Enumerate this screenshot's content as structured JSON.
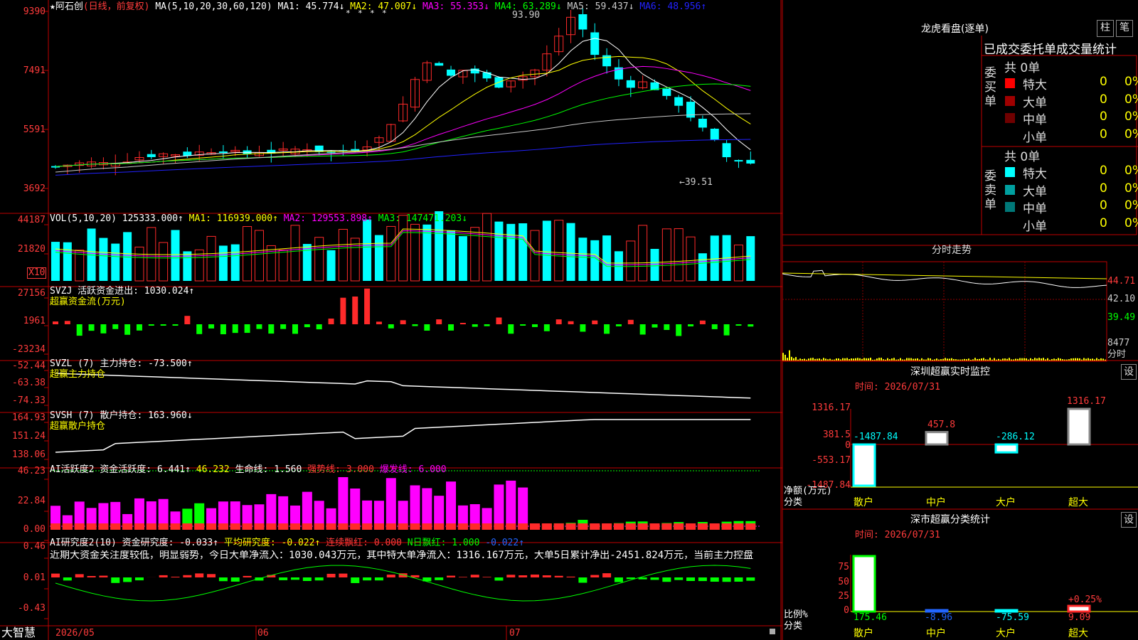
{
  "main": {
    "stock": "阿石创",
    "period": "(日线，前复权)",
    "ma_title": "MA(5,10,20,30,60,120)",
    "ma": [
      {
        "label": "MA1:",
        "value": "45.774↓",
        "color": "#ffffff"
      },
      {
        "label": "MA2:",
        "value": "47.007↓",
        "color": "#ffff00"
      },
      {
        "label": "MA3:",
        "value": "55.353↓",
        "color": "#ff00ff"
      },
      {
        "label": "MA4:",
        "value": "63.289↓",
        "color": "#00ff00"
      },
      {
        "label": "MA5:",
        "value": "59.437↓",
        "color": "#c8c8c8"
      },
      {
        "label": "MA6:",
        "value": "48.956↑",
        "color": "#2222ff"
      }
    ],
    "y": [
      "9390",
      "7491",
      "5591",
      "3692"
    ],
    "high_mark": "93.90",
    "low_mark": "←39.51"
  },
  "vol": {
    "title": "VOL(5,10,20)",
    "value": "125333.000↑",
    "ma": [
      {
        "label": "MA1:",
        "value": "116939.000↑",
        "color": "#ffff00"
      },
      {
        "label": "MA2:",
        "value": "129553.898↑",
        "color": "#ff00ff"
      },
      {
        "label": "MA3:",
        "value": "147471.203↓",
        "color": "#00ff00"
      }
    ],
    "y": [
      "44187",
      "21820"
    ],
    "unit": "X10"
  },
  "svzj": {
    "title": "SVZJ  活跃资金进出: 1030.024↑",
    "sub": "超赢资金流(万元)",
    "y": [
      "27156",
      "1961",
      "-23234"
    ]
  },
  "svzl": {
    "title": "SVZL (7) 主力持仓: -73.500↑",
    "sub": "超赢主力持仓",
    "y": [
      "-52.44",
      "-63.38",
      "-74.33"
    ]
  },
  "svsh": {
    "title": "SVSH (7) 散户持仓: 163.960↓",
    "sub": "超赢散户持仓",
    "y": [
      "164.93",
      "151.24",
      "138.06"
    ]
  },
  "ai1": {
    "title": "AI活跃度2 资金活跃度: 6.441↑",
    "v2": "46.232",
    "life": "生命线: 1.560",
    "strong": "强势线: 3.000",
    "burst": "爆发线: 6.000",
    "y": [
      "46.23",
      "22.84",
      "0.00"
    ]
  },
  "ai2": {
    "title": "AI研究度2(10) 资金研究度: -0.033↑",
    "avg": "平均研究度: -0.022↑",
    "red": "连续飘红: 0.000",
    "nred": "N日飘红: 1.000",
    "last": "-0.022↑",
    "commentary": "近期大资金关注度较低，明显弱势，今日大单净流入：1030.043万元，其中特大单净流入：1316.167万元，大单5日累计净出-2451.824万元，当前主力控盘",
    "y": [
      "0.46",
      "0.01",
      "-0.43"
    ]
  },
  "footer": {
    "brand": "大智慧",
    "months": [
      "2026/05",
      "06",
      "07"
    ]
  },
  "dragon": {
    "title": "龙虎看盘(逐单)",
    "btn1": "柱",
    "btn2": "笔",
    "header": "已成交委托单成交量统计",
    "buy_label": "委买单",
    "sell_label": "委卖单",
    "buy_total": "共 0单",
    "sell_total": "共 0单",
    "buy": [
      {
        "name": "特大",
        "count": "0",
        "pct": "0%",
        "color": "#ff0000"
      },
      {
        "name": "大单",
        "count": "0",
        "pct": "0%",
        "color": "#a00000"
      },
      {
        "name": "中单",
        "count": "0",
        "pct": "0%",
        "color": "#700000"
      },
      {
        "name": "小单",
        "count": "0",
        "pct": "0%",
        "color": ""
      }
    ],
    "sell": [
      {
        "name": "特大",
        "count": "0",
        "pct": "0%",
        "color": "#00ffff"
      },
      {
        "name": "大单",
        "count": "0",
        "pct": "0%",
        "color": "#00a0a0"
      },
      {
        "name": "中单",
        "count": "0",
        "pct": "0%",
        "color": "#007878"
      },
      {
        "name": "小单",
        "count": "0",
        "pct": "0%",
        "color": ""
      }
    ]
  },
  "intraday": {
    "title": "分时走势",
    "y": [
      "44.71",
      "42.10",
      "39.49"
    ],
    "vol": "8477",
    "unit": "分时"
  },
  "sz_monitor": {
    "title": "深圳超赢实时监控",
    "btn": "设",
    "time": "时间: 2026/07/31",
    "y": [
      "1316.17",
      "381.5",
      "0",
      "-553.17",
      "-1487.84"
    ],
    "ylabel": "净额(万元)",
    "xlabel": "分类",
    "cats": [
      "散户",
      "中户",
      "大户",
      "超大"
    ],
    "values": [
      "-1487.84",
      "457.8",
      "-286.12",
      "1316.17"
    ]
  },
  "sz_class": {
    "title": "深市超赢分类统计",
    "btn": "设",
    "time": "时间: 2026/07/31",
    "y": [
      "75",
      "50",
      "25",
      "0"
    ],
    "ylabel": "比例%",
    "xlabel": "分类",
    "cats": [
      "散户",
      "中户",
      "大户",
      "超大"
    ],
    "values": [
      "175.46",
      "-8.96",
      "-75.59",
      "9.09"
    ],
    "tag": "+0.25%"
  },
  "chart_data": {
    "type": "bar",
    "title": "深圳超赢实时监控",
    "categories": [
      "散户",
      "中户",
      "大户",
      "超大"
    ],
    "values": [
      -1487.84,
      457.8,
      -286.12,
      1316.17
    ],
    "ylim": [
      -1487.84,
      1316.17
    ]
  }
}
